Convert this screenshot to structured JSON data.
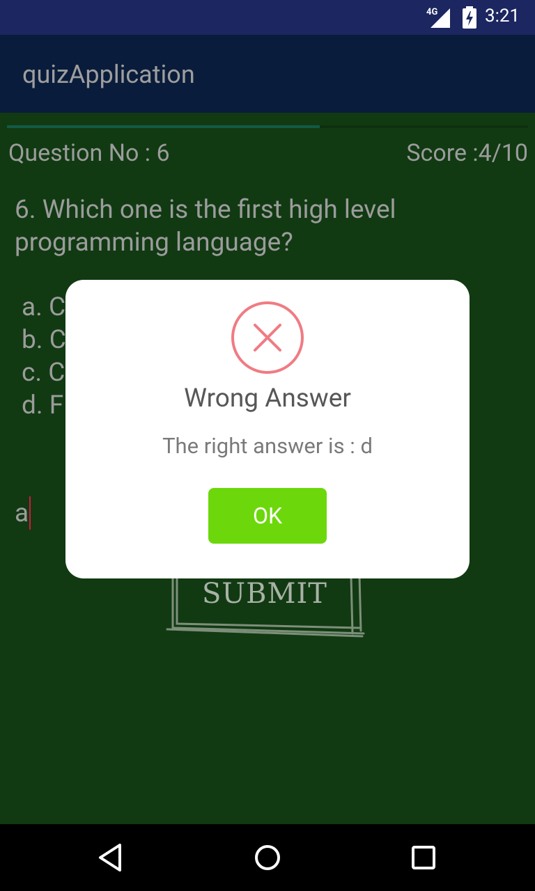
{
  "status_bar": {
    "network": "4G",
    "time": "3:21"
  },
  "app_bar": {
    "title": "quizApplication"
  },
  "quiz": {
    "progress": 0.6,
    "question_no": "Question No : 6",
    "score": "Score :4/10",
    "question": "6. Which one is the first high level programming language?",
    "options": [
      "a. C",
      "b. C",
      "c. C",
      "d. F"
    ],
    "answer_value": "a",
    "submit_label": "SUBMIT"
  },
  "dialog": {
    "icon": "error-x-icon",
    "title": "Wrong Answer",
    "message": "The right answer is : d",
    "ok_label": "OK"
  },
  "colors": {
    "status_bar": "#1c2660",
    "app_bar": "#0a1c3b",
    "background": "#113a12",
    "ok_button": "#6cd80b",
    "error_icon": "#f07b83"
  },
  "nav": {
    "icons": [
      "back-icon",
      "home-icon",
      "recents-icon"
    ]
  }
}
